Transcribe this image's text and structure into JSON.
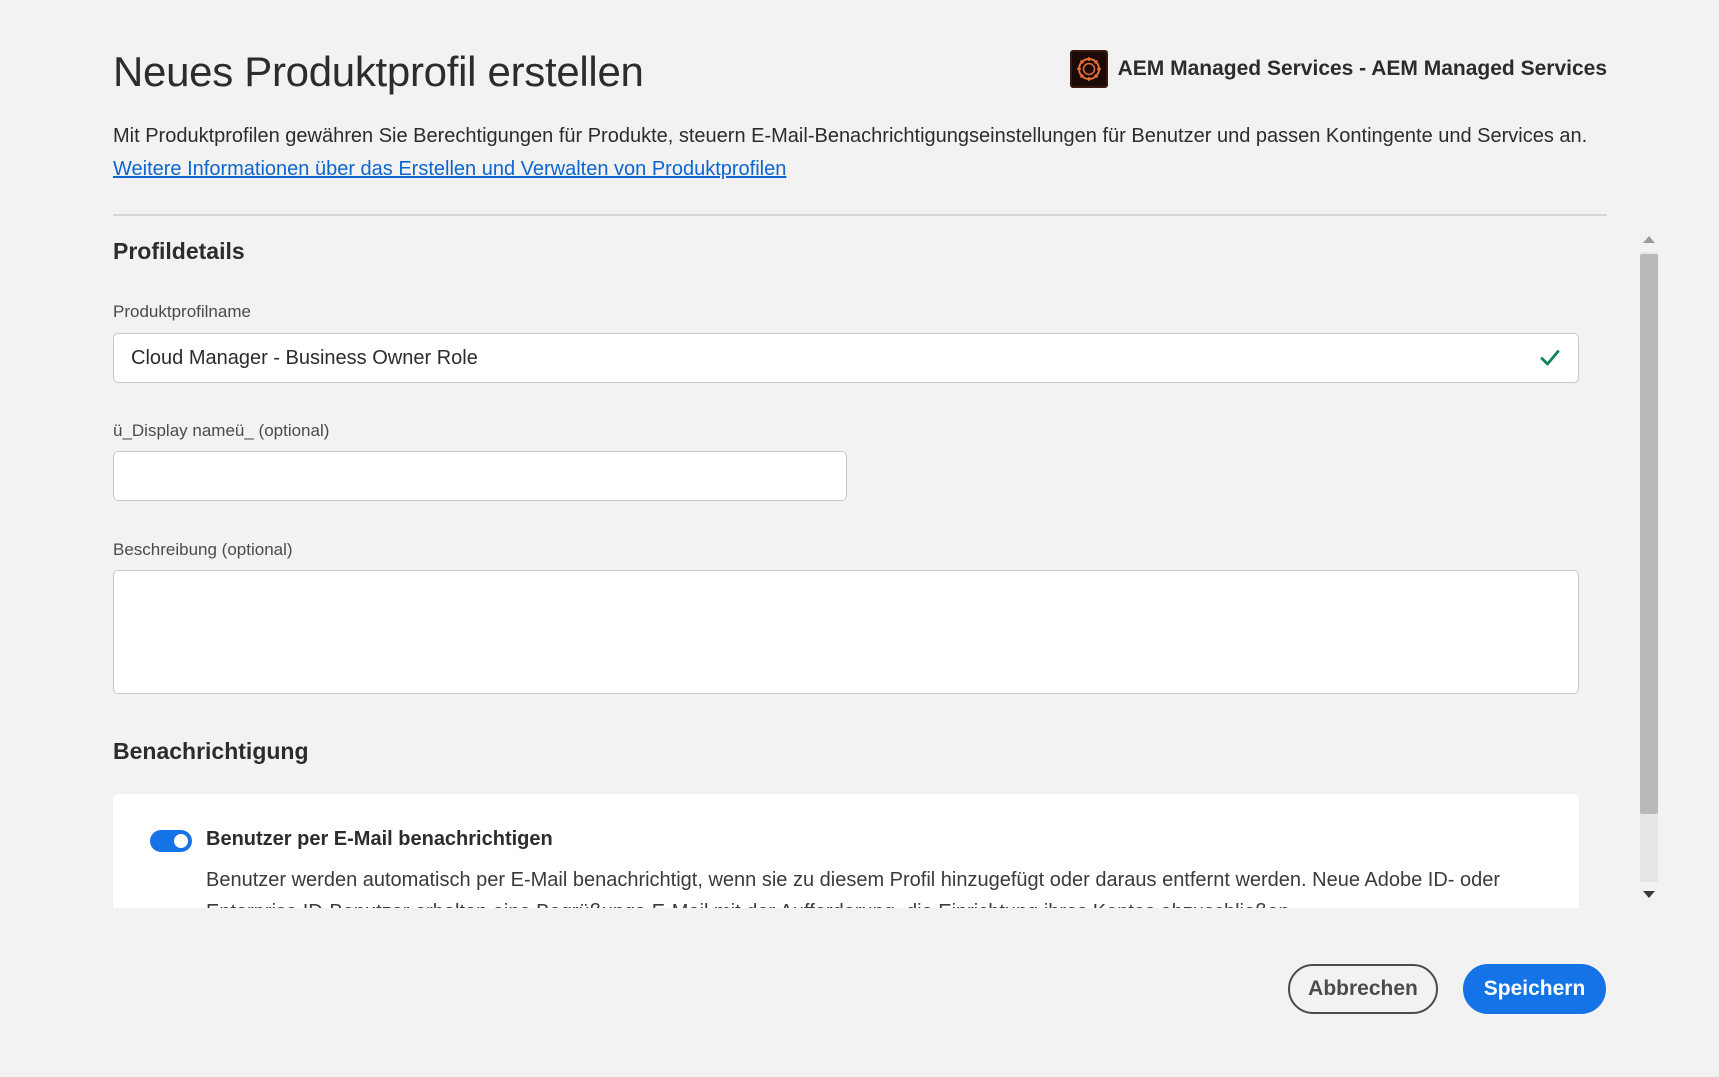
{
  "dialog": {
    "title": "Neues Produktprofil erstellen",
    "product_icon": "aem-managed-services-logo",
    "product_name": "AEM Managed Services - AEM Managed Services",
    "intro": "Mit Produktprofilen gewähren Sie Berechtigungen für Produkte, steuern E-Mail-Benachrichtigungseinstellungen für Benutzer und passen Kontingente und Services an.",
    "learn_more_link": "Weitere Informationen über das Erstellen und Verwalten von Produktprofilen"
  },
  "profile_details": {
    "section_title": "Profildetails",
    "name_label": "Produktprofilname",
    "name_value": "Cloud Manager - Business Owner Role",
    "name_valid_icon": "checkmark-icon",
    "display_name_label": "ü_Display nameü_ (optional)",
    "display_name_value": "",
    "description_label": "Beschreibung (optional)",
    "description_value": ""
  },
  "notification": {
    "section_title": "Benachrichtigung",
    "toggle_label": "Benutzer per E-Mail benachrichtigen",
    "toggle_on": true,
    "toggle_description": "Benutzer werden automatisch per E-Mail benachrichtigt, wenn sie zu diesem Profil hinzugefügt oder daraus entfernt werden. Neue Adobe ID- oder Enterprise ID-Benutzer erhalten eine Begrüßungs-E-Mail mit der Aufforderung, die Einrichtung ihres Kontos abzuschließen."
  },
  "footer": {
    "cancel_label": "Abbrechen",
    "save_label": "Speichern"
  },
  "colors": {
    "accent": "#1473e6",
    "link": "#0d66d0",
    "valid": "#12805c"
  }
}
